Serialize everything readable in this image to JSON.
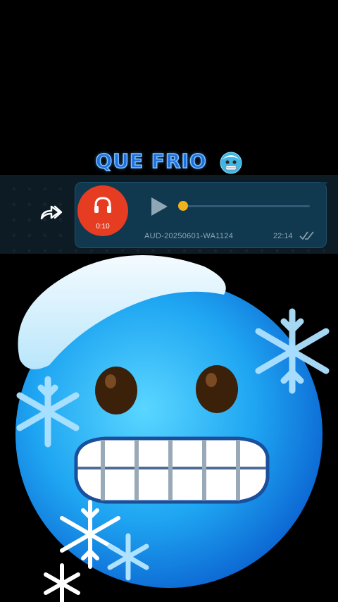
{
  "caption": {
    "title": "QUE FRIO",
    "emoji_icon": "cold-face-emoji"
  },
  "voice_message": {
    "duration": "0:10",
    "filename": "AUD-20250601-WA1124",
    "time": "22:14",
    "status": "read",
    "progress": 0.0
  },
  "colors": {
    "bubble": "#10384f",
    "avatar": "#e63c22",
    "knob": "#f2b21c",
    "title": "#1f6fe0"
  },
  "artwork": {
    "subject": "cold-face-emoji-with-snowflakes"
  }
}
